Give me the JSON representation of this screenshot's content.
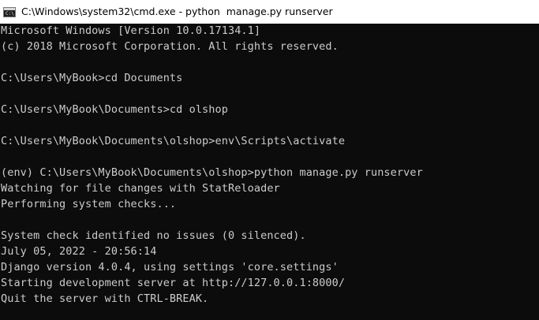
{
  "window": {
    "title": "C:\\Windows\\system32\\cmd.exe - python  manage.py runserver",
    "icon_label": "C:\\",
    "icon": "cmd-icon"
  },
  "console": {
    "lines": [
      "Microsoft Windows [Version 10.0.17134.1]",
      "(c) 2018 Microsoft Corporation. All rights reserved.",
      "",
      "C:\\Users\\MyBook>cd Documents",
      "",
      "C:\\Users\\MyBook\\Documents>cd olshop",
      "",
      "C:\\Users\\MyBook\\Documents\\olshop>env\\Scripts\\activate",
      "",
      "(env) C:\\Users\\MyBook\\Documents\\olshop>python manage.py runserver",
      "Watching for file changes with StatReloader",
      "Performing system checks...",
      "",
      "System check identified no issues (0 silenced).",
      "July 05, 2022 - 20:56:14",
      "Django version 4.0.4, using settings 'core.settings'",
      "Starting development server at http://127.0.0.1:8000/",
      "Quit the server with CTRL-BREAK."
    ]
  },
  "colors": {
    "background": "#0c0c0c",
    "text": "#cccccc",
    "titlebar": "#ffffff"
  }
}
